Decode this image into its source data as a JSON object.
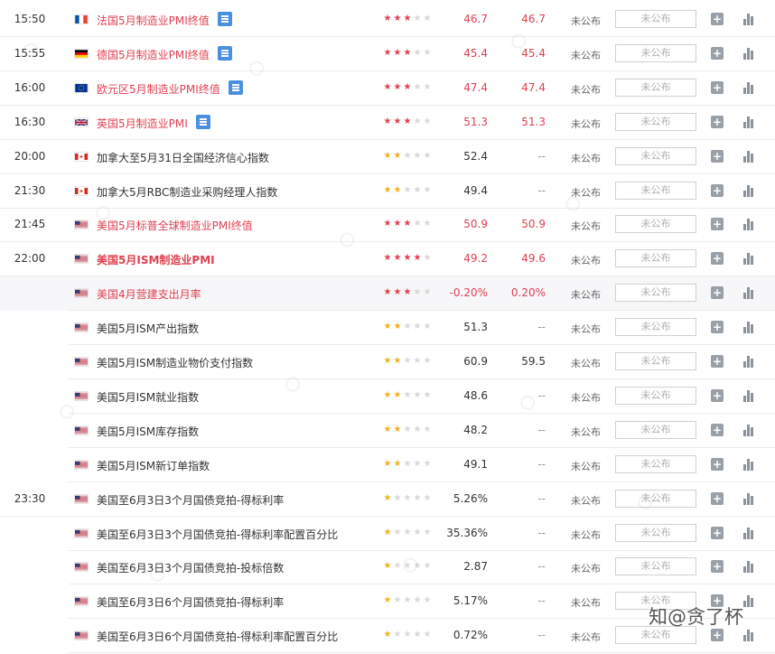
{
  "ui_strings": {
    "actual_label": "未公布",
    "box_label": "未公布",
    "plus_label": "+",
    "credit": "知@贪了杯"
  },
  "colors": {
    "highlight": "#e04050",
    "star_gold": "#f2b01e",
    "star_off": "#d8d8d8",
    "box_border": "#d0d0d0"
  },
  "rows": [
    {
      "time": "15:50",
      "flag": "fr",
      "name": "法国5月制造业PMI终值",
      "doc": true,
      "red": true,
      "bold": false,
      "stars": 3,
      "prev": "46.7",
      "forecast": "46.7",
      "bg": false
    },
    {
      "time": "15:55",
      "flag": "de",
      "name": "德国5月制造业PMI终值",
      "doc": true,
      "red": true,
      "bold": false,
      "stars": 3,
      "prev": "45.4",
      "forecast": "45.4",
      "bg": false
    },
    {
      "time": "16:00",
      "flag": "eu",
      "name": "欧元区5月制造业PMI终值",
      "doc": true,
      "red": true,
      "bold": false,
      "stars": 3,
      "prev": "47.4",
      "forecast": "47.4",
      "bg": false
    },
    {
      "time": "16:30",
      "flag": "gb",
      "name": "英国5月制造业PMI",
      "doc": true,
      "red": true,
      "bold": false,
      "stars": 3,
      "prev": "51.3",
      "forecast": "51.3",
      "bg": false
    },
    {
      "time": "20:00",
      "flag": "ca",
      "name": "加拿大至5月31日全国经济信心指数",
      "doc": false,
      "red": false,
      "bold": false,
      "stars": 2,
      "prev": "52.4",
      "forecast": "--",
      "bg": false
    },
    {
      "time": "21:30",
      "flag": "ca",
      "name": "加拿大5月RBC制造业采购经理人指数",
      "doc": false,
      "red": false,
      "bold": false,
      "stars": 2,
      "prev": "49.4",
      "forecast": "--",
      "bg": false
    },
    {
      "time": "21:45",
      "flag": "us",
      "name": "美国5月标普全球制造业PMI终值",
      "doc": false,
      "red": true,
      "bold": false,
      "stars": 3,
      "prev": "50.9",
      "forecast": "50.9",
      "bg": false
    },
    {
      "time": "22:00",
      "flag": "us",
      "name": "美国5月ISM制造业PMI",
      "doc": false,
      "red": true,
      "bold": true,
      "stars": 4,
      "prev": "49.2",
      "forecast": "49.6",
      "bg": false
    },
    {
      "time": "",
      "flag": "us",
      "name": "美国4月营建支出月率",
      "doc": false,
      "red": true,
      "bold": false,
      "stars": 3,
      "prev": "-0.20%",
      "forecast": "0.20%",
      "bg": true
    },
    {
      "time": "",
      "flag": "us",
      "name": "美国5月ISM产出指数",
      "doc": false,
      "red": false,
      "bold": false,
      "stars": 2,
      "prev": "51.3",
      "forecast": "--",
      "bg": false
    },
    {
      "time": "",
      "flag": "us",
      "name": "美国5月ISM制造业物价支付指数",
      "doc": false,
      "red": false,
      "bold": false,
      "stars": 2,
      "prev": "60.9",
      "forecast": "59.5",
      "bg": false
    },
    {
      "time": "",
      "flag": "us",
      "name": "美国5月ISM就业指数",
      "doc": false,
      "red": false,
      "bold": false,
      "stars": 2,
      "prev": "48.6",
      "forecast": "--",
      "bg": false
    },
    {
      "time": "",
      "flag": "us",
      "name": "美国5月ISM库存指数",
      "doc": false,
      "red": false,
      "bold": false,
      "stars": 2,
      "prev": "48.2",
      "forecast": "--",
      "bg": false
    },
    {
      "time": "",
      "flag": "us",
      "name": "美国5月ISM新订单指数",
      "doc": false,
      "red": false,
      "bold": false,
      "stars": 2,
      "prev": "49.1",
      "forecast": "--",
      "bg": false
    },
    {
      "time": "23:30",
      "flag": "us",
      "name": "美国至6月3日3个月国债竞拍-得标利率",
      "doc": false,
      "red": false,
      "bold": false,
      "stars": 1,
      "prev": "5.26%",
      "forecast": "--",
      "bg": false
    },
    {
      "time": "",
      "flag": "us",
      "name": "美国至6月3日3个月国债竞拍-得标利率配置百分比",
      "doc": false,
      "red": false,
      "bold": false,
      "stars": 1,
      "prev": "35.36%",
      "forecast": "--",
      "bg": false
    },
    {
      "time": "",
      "flag": "us",
      "name": "美国至6月3日3个月国债竞拍-投标倍数",
      "doc": false,
      "red": false,
      "bold": false,
      "stars": 1,
      "prev": "2.87",
      "forecast": "--",
      "bg": false
    },
    {
      "time": "",
      "flag": "us",
      "name": "美国至6月3日6个月国债竞拍-得标利率",
      "doc": false,
      "red": false,
      "bold": false,
      "stars": 1,
      "prev": "5.17%",
      "forecast": "--",
      "bg": false
    },
    {
      "time": "",
      "flag": "us",
      "name": "美国至6月3日6个月国债竞拍-得标利率配置百分比",
      "doc": false,
      "red": false,
      "bold": false,
      "stars": 1,
      "prev": "0.72%",
      "forecast": "--",
      "bg": false
    }
  ]
}
